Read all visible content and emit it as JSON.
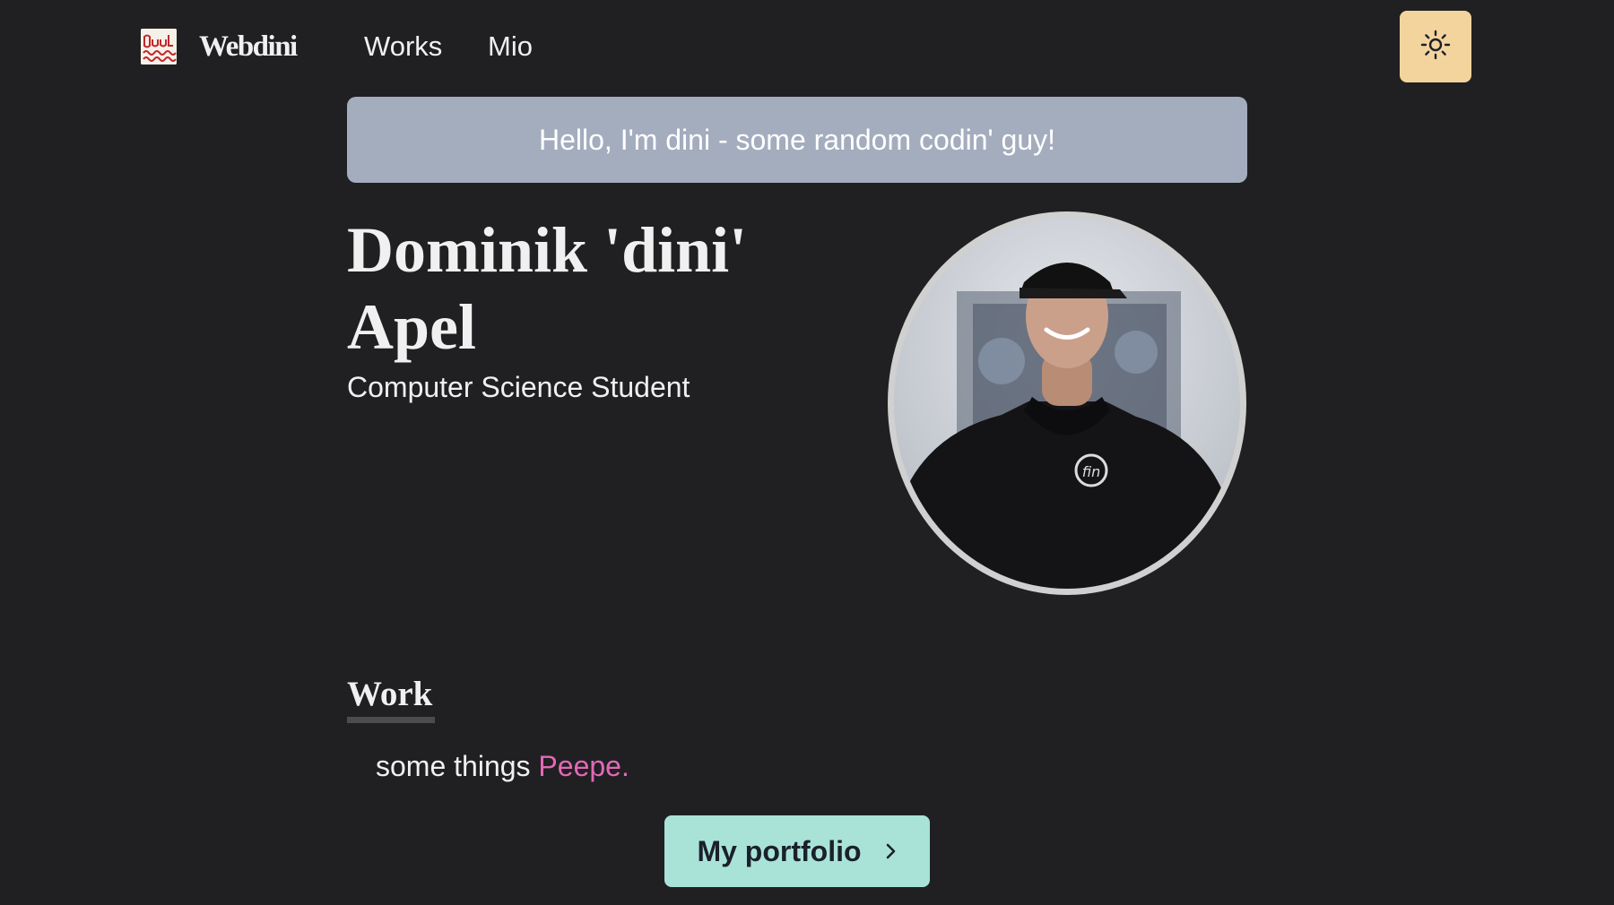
{
  "nav": {
    "brand": "Webdini",
    "links": [
      "Works",
      "Mio"
    ],
    "theme_icon": "sun-icon"
  },
  "hero": {
    "greeting": "Hello, I'm dini - some random codin' guy!",
    "name": "Dominik 'dini' Apel",
    "job": "Computer Science Student"
  },
  "work": {
    "heading": "Work",
    "text_prefix": "some things ",
    "link_text": "Peepe.",
    "button_label": "My portfolio",
    "button_icon": "chevron-right-icon"
  },
  "colors": {
    "background": "#202023",
    "banner": "#a4adbe",
    "theme_button": "#f4d49d",
    "portfolio_button": "#a9e3d8",
    "accent_link": "#e468b6"
  }
}
